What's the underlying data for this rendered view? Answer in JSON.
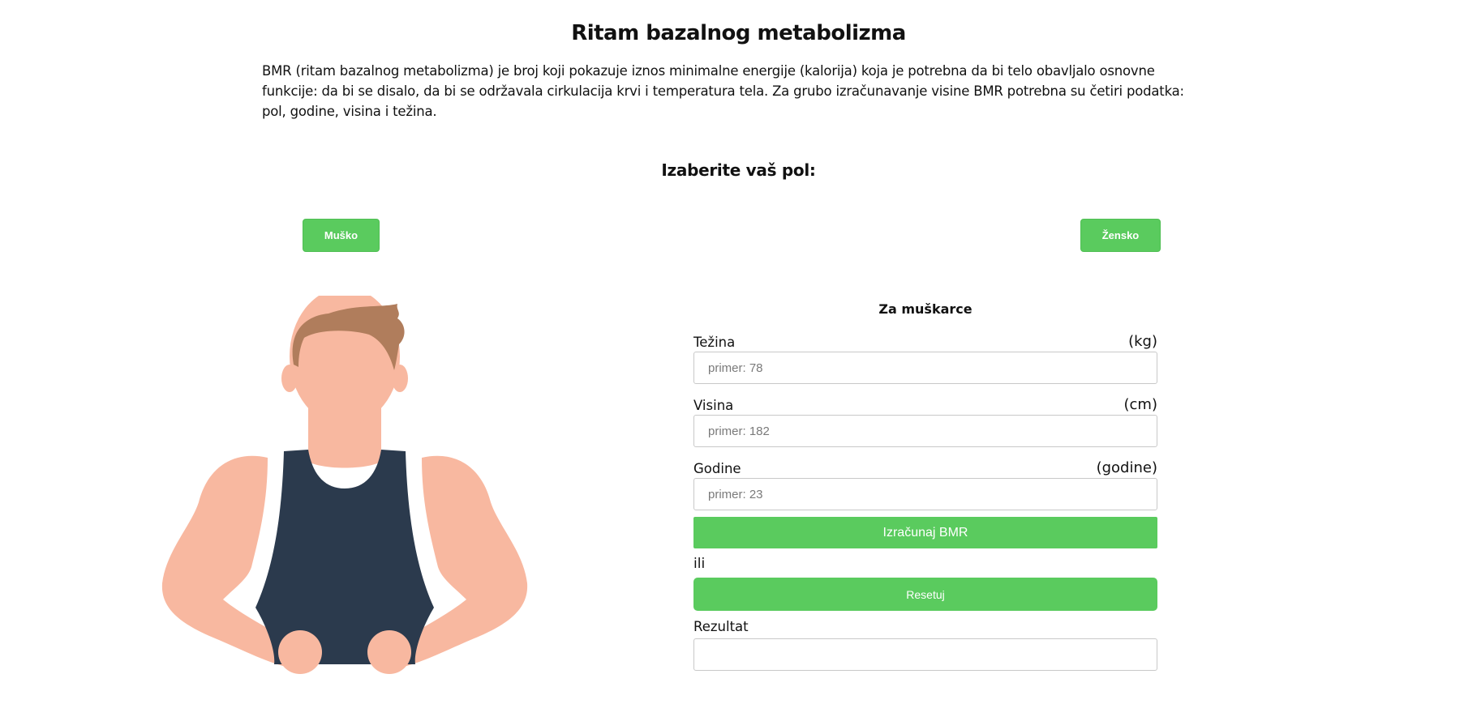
{
  "header": {
    "title": "Ritam bazalnog metabolizma",
    "intro": "BMR (ritam bazalnog metabolizma) je broj koji pokazuje iznos minimalne energije (kalorija) koja je potrebna da bi telo obavljalo osnovne funkcije: da bi se disalo, da bi se održavala cirkulacija krvi i temperatura tela. Za grubo izračunavanje visine BMR potrebna su četiri podatka: pol, godine, visina i težina."
  },
  "gender": {
    "heading": "Izaberite vaš pol:",
    "male_label": "Muško",
    "female_label": "Žensko"
  },
  "form": {
    "title": "Za muškarce",
    "weight": {
      "label": "Težina",
      "unit": "(kg)",
      "placeholder": "primer: 78"
    },
    "height": {
      "label": "Visina",
      "unit": "(cm)",
      "placeholder": "primer: 182"
    },
    "age": {
      "label": "Godine",
      "unit": "(godine)",
      "placeholder": "primer: 23"
    },
    "calculate_label": "Izračunaj BMR",
    "or_text": "ili",
    "reset_label": "Resetuj",
    "result_label": "Rezultat",
    "result_value": ""
  },
  "colors": {
    "accent": "#5acb5e",
    "skin": "#f8b8a0",
    "hair": "#b07d5c",
    "tank_top": "#2b3a4d"
  },
  "icons": {
    "illustration": "male-bodybuilder-illustration"
  }
}
